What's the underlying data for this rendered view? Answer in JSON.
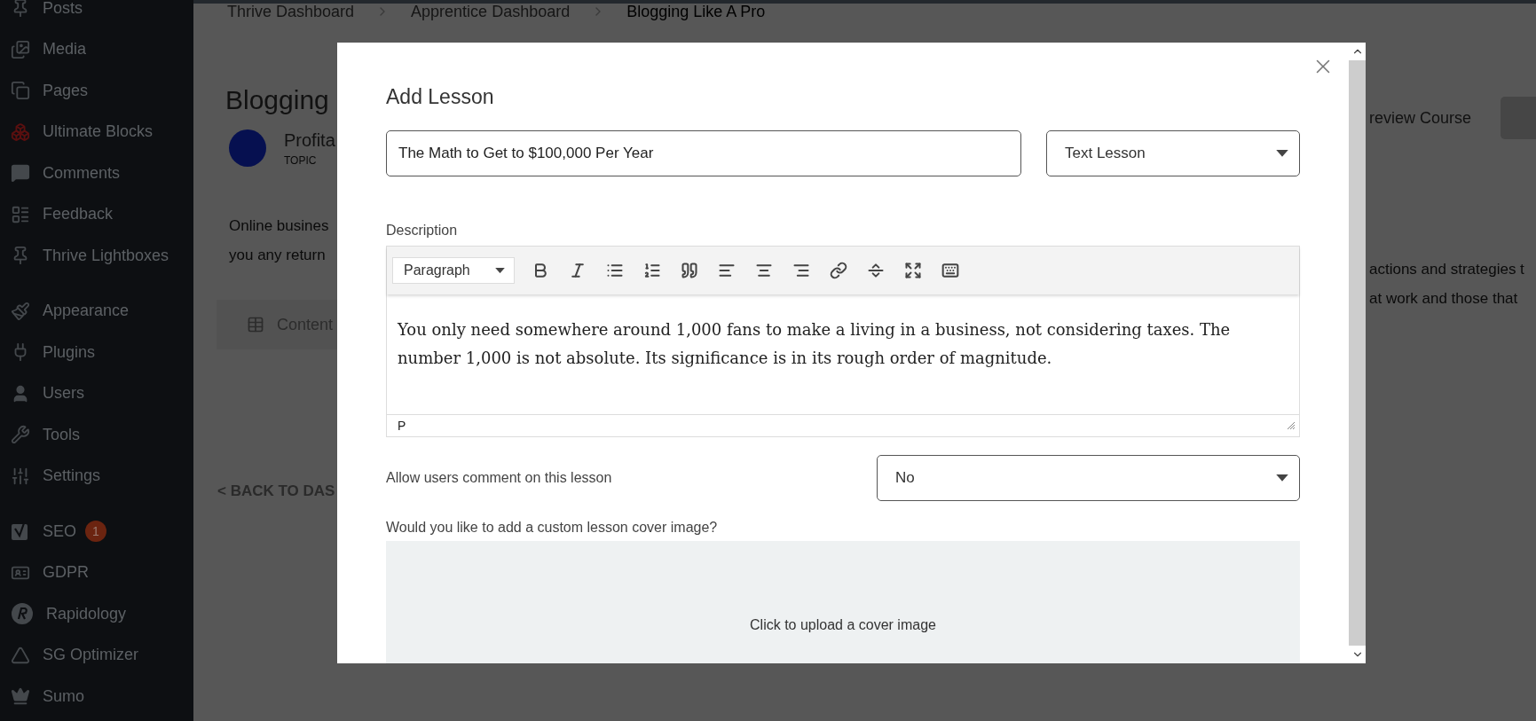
{
  "sidebar": {
    "groups": [
      [
        {
          "label": "Posts"
        },
        {
          "label": "Media"
        },
        {
          "label": "Pages"
        },
        {
          "label": "Ultimate Blocks"
        },
        {
          "label": "Comments"
        },
        {
          "label": "Feedback"
        },
        {
          "label": "Thrive Lightboxes"
        }
      ],
      [
        {
          "label": "Appearance"
        },
        {
          "label": "Plugins"
        },
        {
          "label": "Users"
        },
        {
          "label": "Tools"
        },
        {
          "label": "Settings"
        }
      ],
      [
        {
          "label": "SEO",
          "badge": "1"
        },
        {
          "label": "GDPR"
        },
        {
          "label": "Rapidology"
        },
        {
          "label": "SG Optimizer"
        },
        {
          "label": "Sumo"
        }
      ]
    ]
  },
  "breadcrumbs": [
    {
      "label": "Thrive Dashboard",
      "current": false
    },
    {
      "label": "Apprentice Dashboard",
      "current": false
    },
    {
      "label": "Blogging Like A Pro",
      "current": true
    }
  ],
  "background_page": {
    "title": "Blogging",
    "topic_name": "Profita",
    "topic_label": "TOPIC",
    "description_left": [
      "Online busines",
      "you any return"
    ],
    "description_right": [
      "actions and strategies t",
      "at work and those that"
    ],
    "tab": "Content",
    "back_link": "< BACK TO DAS",
    "preview_link": "review Course"
  },
  "modal": {
    "title": "Add Lesson",
    "lesson_title": {
      "value": "The Math to Get to $100,000 Per Year"
    },
    "lesson_type": {
      "value": "Text Lesson"
    },
    "description_label": "Description",
    "editor": {
      "format": "Paragraph",
      "body": "You only need somewhere around 1,000 fans to make a living in a business, not considering taxes. The number 1,000 is not absolute. Its significance is in its rough order of magnitude.",
      "path": "P"
    },
    "comments_label": "Allow users comment on this lesson",
    "comments_select": {
      "value": "No"
    },
    "cover_label": "Would you like to add a custom lesson cover image?",
    "upload_text": "Click to upload a cover image"
  }
}
